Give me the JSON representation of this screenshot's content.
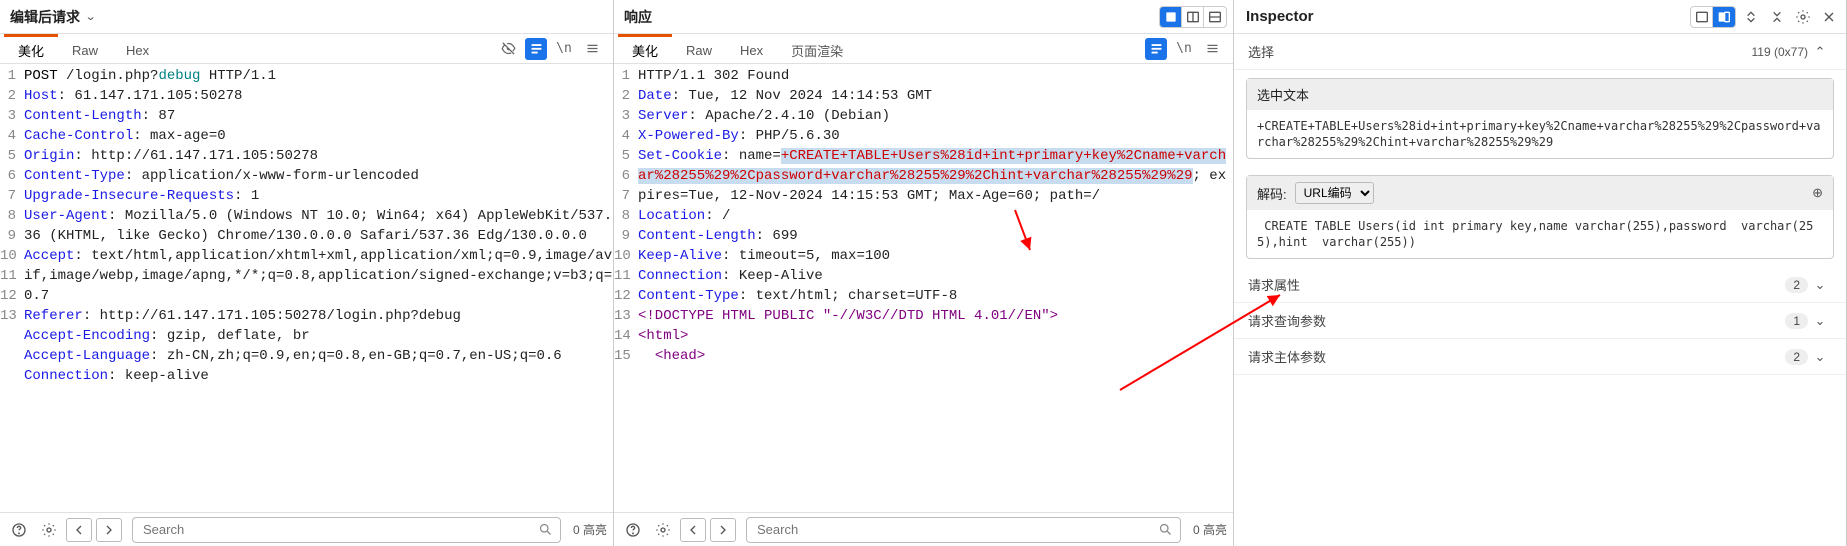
{
  "request": {
    "title": "编辑后请求",
    "tabs": {
      "beautify": "美化",
      "raw": "Raw",
      "hex": "Hex"
    },
    "search_placeholder": "Search",
    "match_label": "0 高亮",
    "lines": [
      {
        "method": "POST",
        "path": " /login.php?",
        "param": "debug",
        "proto": " HTTP/1.1"
      },
      {
        "key": "Host",
        "val": " 61.147.171.105:50278"
      },
      {
        "key": "Content-Length",
        "val": " 87"
      },
      {
        "key": "Cache-Control",
        "val": " max-age=0"
      },
      {
        "key": "Origin",
        "val": " http://61.147.171.105:50278"
      },
      {
        "key": "Content-Type",
        "val": " application/x-www-form-urlencoded"
      },
      {
        "key": "Upgrade-Insecure-Requests",
        "val": " 1"
      },
      {
        "key": "User-Agent",
        "val": " Mozilla/5.0 (Windows NT 10.0; Win64; x64) AppleWebKit/537.36 (KHTML, like Gecko) Chrome/130.0.0.0 Safari/537.36 Edg/130.0.0.0"
      },
      {
        "key": "Accept",
        "val": " text/html,application/xhtml+xml,application/xml;q=0.9,image/avif,image/webp,image/apng,*/*;q=0.8,application/signed-exchange;v=b3;q=0.7"
      },
      {
        "key": "Referer",
        "val": " http://61.147.171.105:50278/login.php?debug"
      },
      {
        "key": "Accept-Encoding",
        "val": " gzip, deflate, br"
      },
      {
        "key": "Accept-Language",
        "val": " zh-CN,zh;q=0.9,en;q=0.8,en-GB;q=0.7,en-US;q=0.6"
      },
      {
        "key": "Connection",
        "val": " keep-alive"
      }
    ]
  },
  "response": {
    "title": "响应",
    "tabs": {
      "beautify": "美化",
      "raw": "Raw",
      "hex": "Hex",
      "render": "页面渲染"
    },
    "search_placeholder": "Search",
    "match_label": "0 高亮",
    "status_line": "HTTP/1.1 302 Found",
    "lines_before": [
      {
        "key": "Date",
        "val": " Tue, 12 Nov 2024 14:14:53 GMT"
      },
      {
        "key": "Server",
        "val": " Apache/2.4.10 (Debian)"
      },
      {
        "key": "X-Powered-By",
        "val": " PHP/5.6.30"
      }
    ],
    "cookie_key": "Set-Cookie",
    "cookie_prefix": " name=",
    "cookie_hl": "+CREATE+TABLE+Users%28id+int+primary+key%2Cname+varchar%28255%29%2Cpassword+varchar%28255%29%2Chint+varchar%28255%29%29",
    "cookie_suffix": "; expires=Tue, 12-Nov-2024 14:15:53 GMT; Max-Age=60; path=/",
    "lines_after": [
      {
        "key": "Location",
        "val": " /"
      },
      {
        "key": "Content-Length",
        "val": " 699"
      },
      {
        "key": "Keep-Alive",
        "val": " timeout=5, max=100"
      },
      {
        "key": "Connection",
        "val": " Keep-Alive"
      },
      {
        "key": "Content-Type",
        "val": " text/html; charset=UTF-8"
      }
    ],
    "body": [
      {
        "txt": ""
      },
      {
        "tag": "<!DOCTYPE HTML PUBLIC \"-//W3C//DTD HTML 4.01//EN\">"
      },
      {
        "txt": ""
      },
      {
        "tag": "<html>"
      },
      {
        "tag": "  <head>"
      }
    ]
  },
  "inspector": {
    "title": "Inspector",
    "select_label": "选择",
    "select_value": "119 (0x77)",
    "selected_text_label": "选中文本",
    "selected_text": "+CREATE+TABLE+Users%28id+int+primary+key%2Cname+varchar%28255%29%2Cpassword+varchar%28255%29%2Chint+varchar%28255%29%29",
    "decode_label": "解码:",
    "decode_type": "URL编码",
    "decoded_text": " CREATE TABLE Users(id int primary key,name varchar(255),password  varchar(255),hint  varchar(255))",
    "attrs_label": "请求属性",
    "attrs_count": "2",
    "query_label": "请求查询参数",
    "query_count": "1",
    "body_label": "请求主体参数",
    "body_count": "2"
  }
}
